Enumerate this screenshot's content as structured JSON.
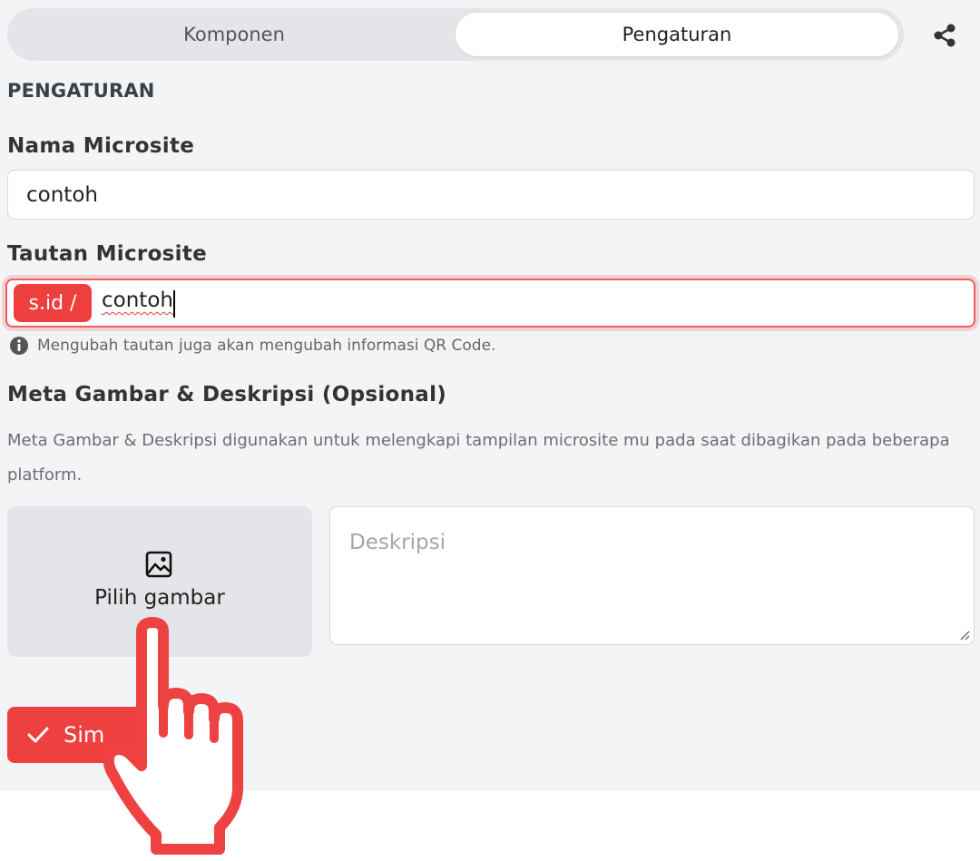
{
  "tabs": {
    "komponen": "Komponen",
    "pengaturan": "Pengaturan"
  },
  "section_title": "PENGATURAN",
  "nama": {
    "label": "Nama Microsite",
    "value": "contoh"
  },
  "tautan": {
    "label": "Tautan Microsite",
    "prefix": "s.id  /",
    "value": "contoh",
    "hint": "Mengubah tautan juga akan mengubah informasi QR Code."
  },
  "meta": {
    "label": "Meta Gambar & Deskripsi (Opsional)",
    "description": "Meta Gambar & Deskripsi digunakan untuk melengkapi tampilan microsite mu pada saat dibagikan pada beberapa platform.",
    "image_button": "Pilih gambar",
    "desc_placeholder": "Deskripsi"
  },
  "save_button": "Sim",
  "icons": {
    "share": "share-icon",
    "info": "info-icon",
    "image": "image-icon",
    "check": "check-icon",
    "pointer": "hand-pointer-icon"
  },
  "colors": {
    "accent": "#ef4040",
    "panel_bg": "#f3f4f6",
    "tab_bg": "#e4e5e8"
  }
}
